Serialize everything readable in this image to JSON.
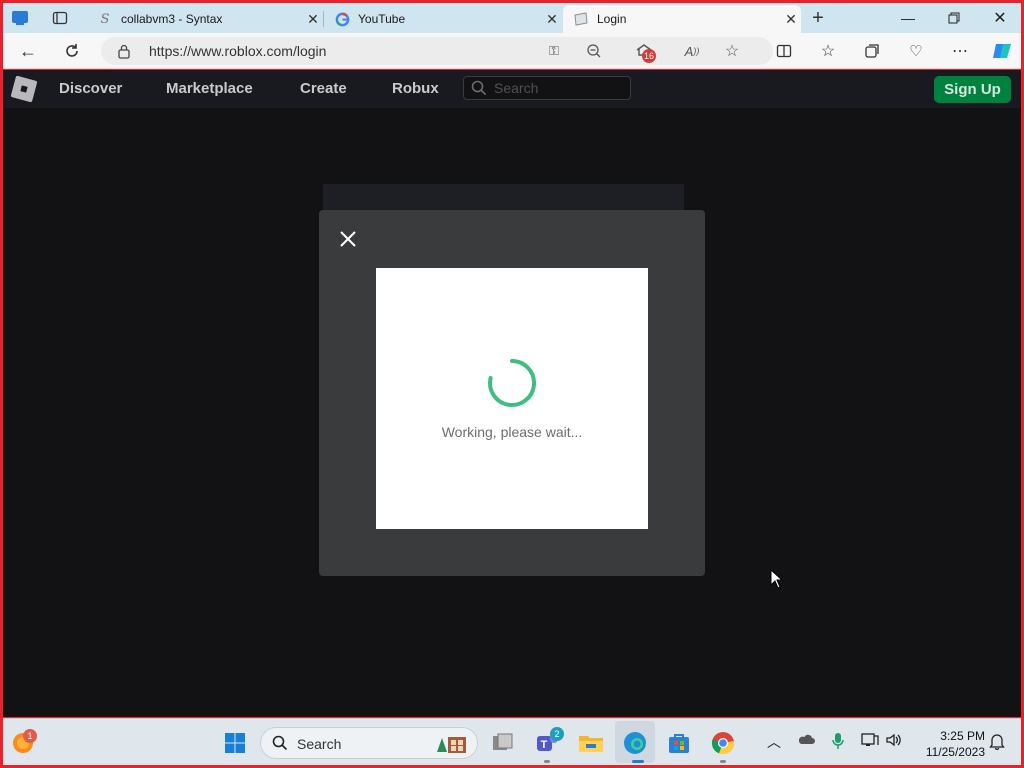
{
  "browser": {
    "tabs": [
      {
        "title": "collabvm3 - Syntax",
        "favicon": "syntax-s-icon"
      },
      {
        "title": "YouTube",
        "favicon": "google-g-icon"
      },
      {
        "title": "Login",
        "favicon": "page-icon"
      }
    ],
    "active_tab": 2,
    "url": "https://www.roblox.com/login",
    "tracking_badge": "16"
  },
  "site": {
    "nav": [
      "Discover",
      "Marketplace",
      "Create",
      "Robux"
    ],
    "search_placeholder": "Search",
    "signup_label": "Sign Up",
    "accent_color": "#00823f"
  },
  "modal": {
    "status_text": "Working, please wait...",
    "spinner_color": "#3fbf7f"
  },
  "taskbar": {
    "search_label": "Search",
    "firefox_badge": "1",
    "teams_badge": "2",
    "time": "3:25 PM",
    "date": "11/25/2023"
  }
}
